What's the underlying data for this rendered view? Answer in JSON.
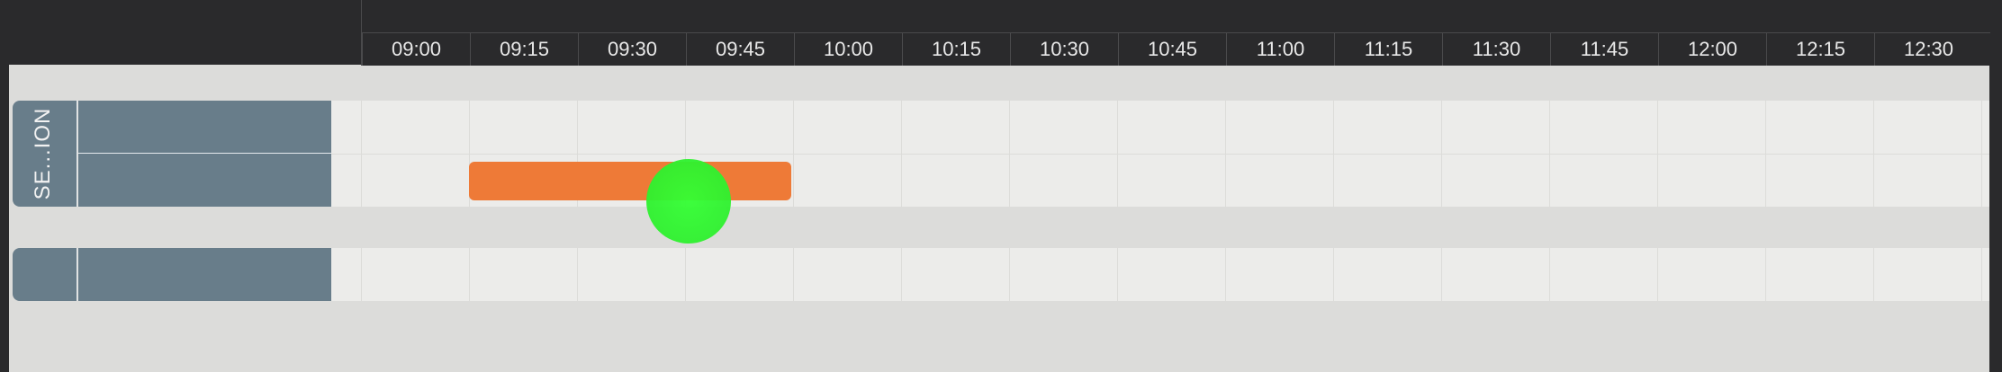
{
  "timeline": {
    "times": [
      "09:00",
      "09:15",
      "09:30",
      "09:45",
      "10:00",
      "10:15",
      "10:30",
      "10:45",
      "11:00",
      "11:15",
      "11:30",
      "11:45",
      "12:00",
      "12:15",
      "12:30"
    ]
  },
  "lanes": [
    {
      "label": "SE...ION"
    },
    {
      "label": ""
    }
  ],
  "colors": {
    "header": "#2a2a2c",
    "lane_label": "#687d8a",
    "event": "#ee7a37",
    "touch_indicator": "#33ff33"
  }
}
